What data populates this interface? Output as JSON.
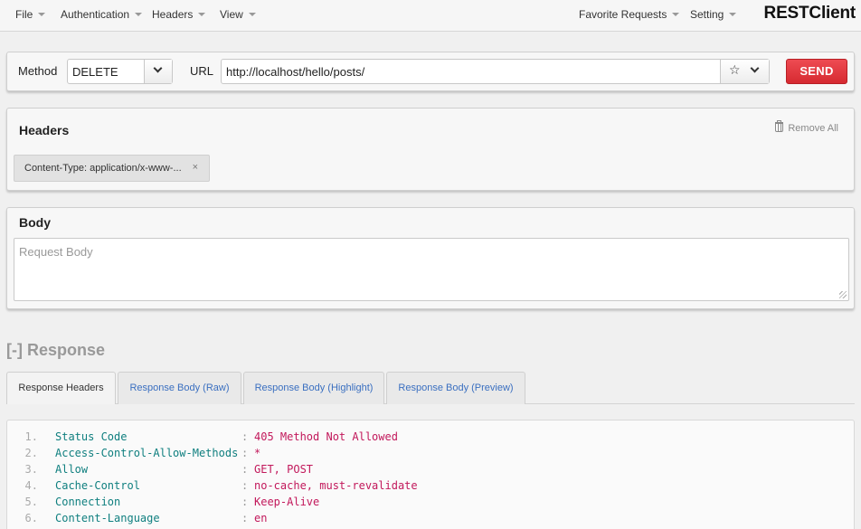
{
  "nav": {
    "file": "File",
    "authentication": "Authentication",
    "headers": "Headers",
    "view": "View",
    "favorite_requests": "Favorite Requests",
    "setting": "Setting",
    "brand": "RESTClient"
  },
  "request": {
    "method_label": "Method",
    "method_value": "DELETE",
    "url_label": "URL",
    "url_value": "http://localhost/hello/posts/",
    "favorite_star": "☆",
    "send_label": "SEND"
  },
  "headers_panel": {
    "title": "Headers",
    "remove_all": "Remove All",
    "tags": [
      {
        "text": "Content-Type: application/x-www-...",
        "close": "×"
      }
    ]
  },
  "body_panel": {
    "title": "Body",
    "placeholder": "Request Body"
  },
  "response": {
    "title": "[-] Response",
    "tabs": [
      {
        "label": "Response Headers",
        "active": true
      },
      {
        "label": "Response Body (Raw)",
        "active": false
      },
      {
        "label": "Response Body (Highlight)",
        "active": false
      },
      {
        "label": "Response Body (Preview)",
        "active": false
      }
    ],
    "rows": [
      {
        "num": "1.",
        "key": "Status Code",
        "sep": ":",
        "value": "405 Method Not Allowed"
      },
      {
        "num": "2.",
        "key": "Access-Control-Allow-Methods",
        "sep": ":",
        "value": "*"
      },
      {
        "num": "3.",
        "key": "Allow",
        "sep": ":",
        "value": "GET, POST"
      },
      {
        "num": "4.",
        "key": "Cache-Control",
        "sep": ":",
        "value": "no-cache, must-revalidate"
      },
      {
        "num": "5.",
        "key": "Connection",
        "sep": ":",
        "value": "Keep-Alive"
      },
      {
        "num": "6.",
        "key": "Content-Language",
        "sep": ":",
        "value": "en"
      }
    ]
  },
  "colors": {
    "send_button": "#e0353c",
    "tab_link": "#3a6fc0",
    "header_key": "#0f7f7f",
    "header_value": "#c2185b"
  }
}
